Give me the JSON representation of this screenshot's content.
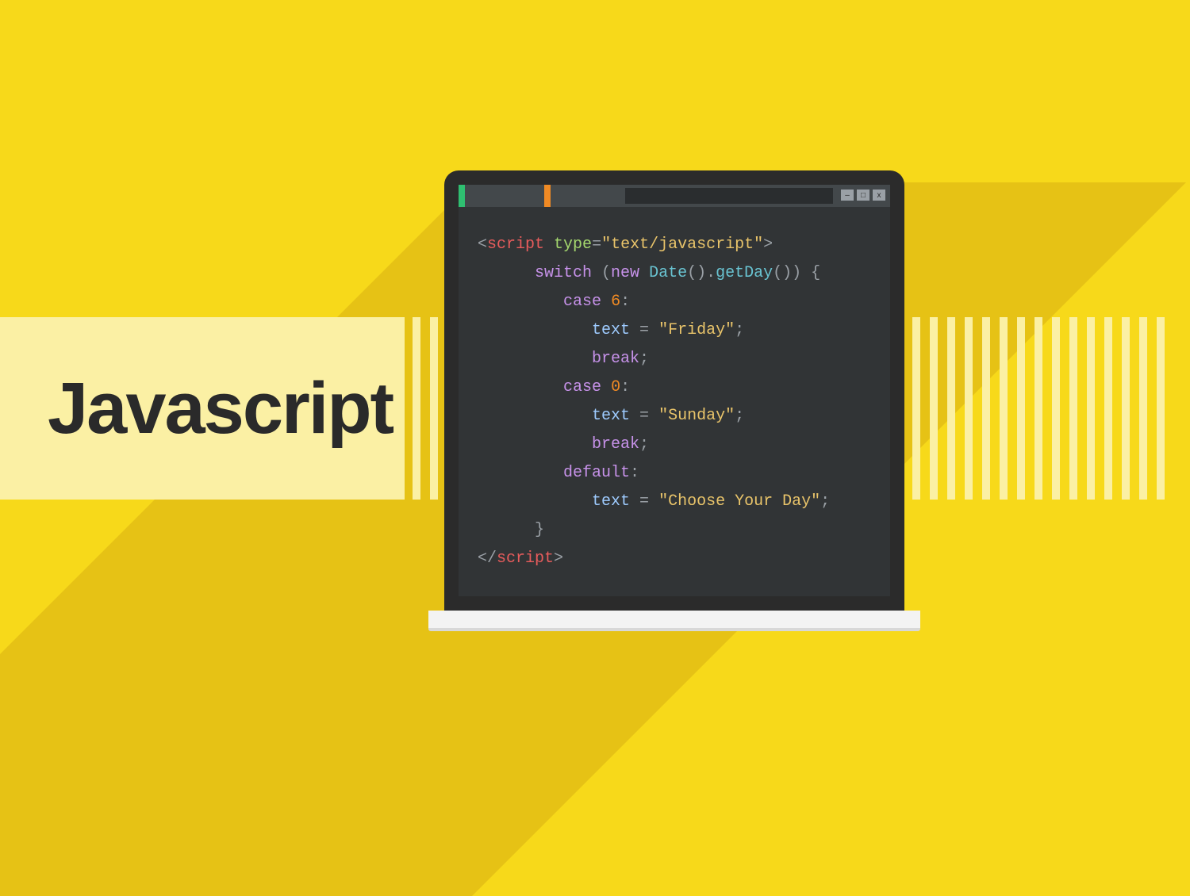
{
  "title": "Javascript",
  "window": {
    "minimize": "–",
    "maximize": "□",
    "close": "x"
  },
  "code": {
    "l1": {
      "open": "<",
      "tag": "script",
      "sp": " ",
      "attr": "type",
      "eq": "=",
      "val": "\"text/javascript\"",
      "close": ">"
    },
    "l2": {
      "kw": "switch",
      "sp": " (",
      "kw2": "new",
      "sp2": " ",
      "fn": "Date",
      "p1": "().",
      "fn2": "getDay",
      "p2": "()) {"
    },
    "l3": {
      "kw": "case",
      "sp": " ",
      "num": "6",
      "colon": ":"
    },
    "l4": {
      "var": "text",
      "eq": " = ",
      "str": "\"Friday\"",
      "semi": ";"
    },
    "l5": {
      "kw": "break",
      "semi": ";"
    },
    "l6": {
      "kw": "case",
      "sp": " ",
      "num": "0",
      "colon": ":"
    },
    "l7": {
      "var": "text",
      "eq": " = ",
      "str": "\"Sunday\"",
      "semi": ";"
    },
    "l8": {
      "kw": "break",
      "semi": ";"
    },
    "l9": {
      "kw": "default",
      "colon": ":"
    },
    "l10": {
      "var": "text",
      "eq": " = ",
      "str": "\"Choose Your Day\"",
      "semi": ";"
    },
    "l11": {
      "brace": "}"
    },
    "l12": {
      "open": "</",
      "tag": "script",
      "close": ">"
    }
  }
}
